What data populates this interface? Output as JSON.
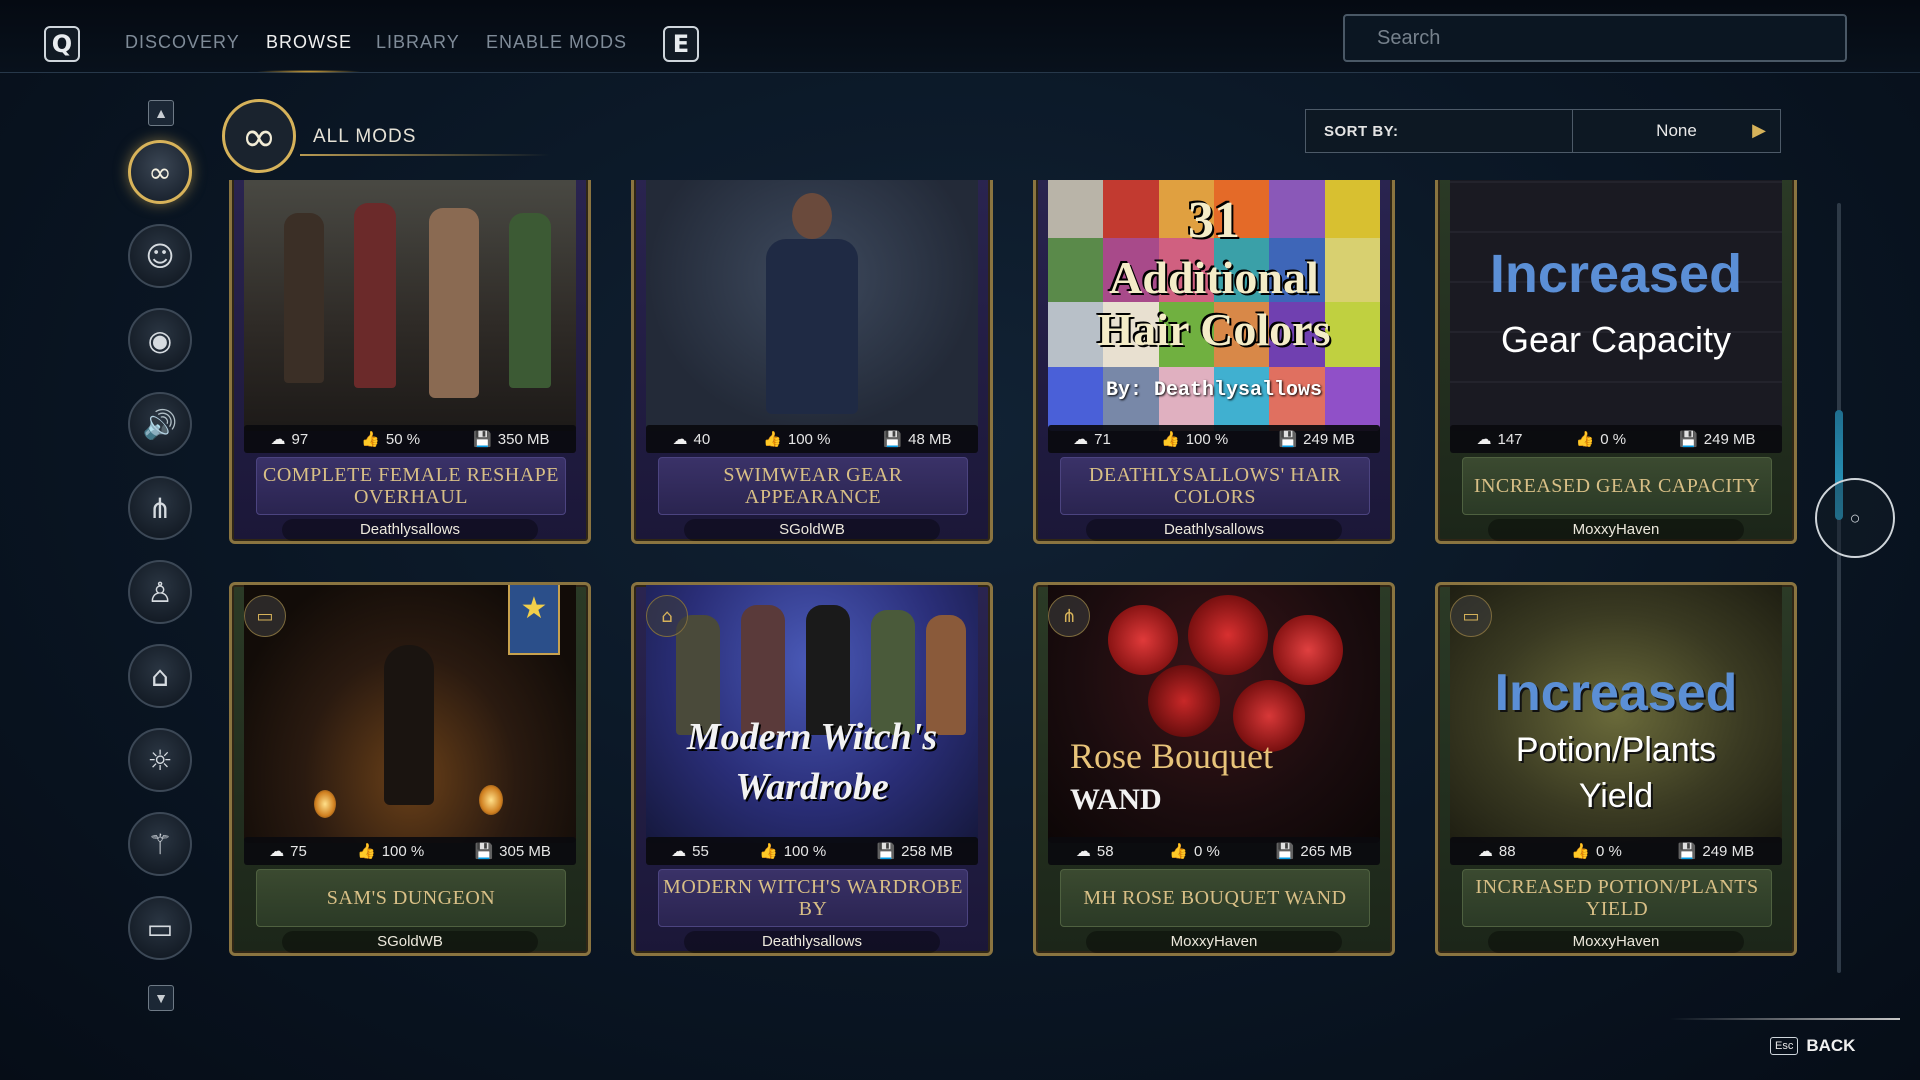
{
  "topbar": {
    "left_key": "Q",
    "right_key": "E",
    "tabs": [
      {
        "label": "DISCOVERY",
        "active": false
      },
      {
        "label": "BROWSE",
        "active": true
      },
      {
        "label": "LIBRARY",
        "active": false
      },
      {
        "label": "ENABLE MODS",
        "active": false
      }
    ],
    "search_placeholder": "Search"
  },
  "sidebar": {
    "items": [
      {
        "icon": "infinity-icon",
        "glyph": "∞",
        "active": true
      },
      {
        "icon": "head-icon",
        "glyph": "☺"
      },
      {
        "icon": "eye-icon",
        "glyph": "◉"
      },
      {
        "icon": "speaker-icon",
        "glyph": "🔊"
      },
      {
        "icon": "network-icon",
        "glyph": "⋔"
      },
      {
        "icon": "person-icon",
        "glyph": "♙"
      },
      {
        "icon": "outfit-icon",
        "glyph": "⌂"
      },
      {
        "icon": "lightbulb-icon",
        "glyph": "☼"
      },
      {
        "icon": "broom-icon",
        "glyph": "⚚"
      },
      {
        "icon": "gamepad-icon",
        "glyph": "▭"
      }
    ]
  },
  "category": {
    "label": "ALL MODS",
    "glyph": "∞"
  },
  "sort": {
    "label": "SORT BY:",
    "value": "None"
  },
  "mods": [
    {
      "title": "COMPLETE FEMALE RESHAPE OVERHAUL",
      "author": "Deathlysallows",
      "downloads": "97",
      "rating": "50 %",
      "size": "350 MB",
      "theme": "purple"
    },
    {
      "title": "SWIMWEAR GEAR APPEARANCE",
      "author": "SGoldWB",
      "downloads": "40",
      "rating": "100 %",
      "size": "48 MB",
      "theme": "purple"
    },
    {
      "title": "DEATHLYSALLOWS' HAIR COLORS",
      "author": "Deathlysallows",
      "downloads": "71",
      "rating": "100 %",
      "size": "249 MB",
      "theme": "purple",
      "art": {
        "line1": "31",
        "line2": "Additional",
        "line3": "Hair Colors",
        "byline": "By: Deathlysallows"
      }
    },
    {
      "title": "INCREASED GEAR CAPACITY",
      "author": "MoxxyHaven",
      "downloads": "147",
      "rating": "0 %",
      "size": "249 MB",
      "theme": "green",
      "art": {
        "line1": "Increased",
        "line2": "Gear Capacity"
      }
    },
    {
      "title": "SAM'S DUNGEON",
      "author": "SGoldWB",
      "downloads": "75",
      "rating": "100 %",
      "size": "305 MB",
      "theme": "green",
      "favorite": true
    },
    {
      "title": "MODERN WITCH'S WARDROBE BY",
      "author": "Deathlysallows",
      "downloads": "55",
      "rating": "100 %",
      "size": "258 MB",
      "theme": "purple",
      "art": {
        "line1": "Modern Witch's",
        "line2": "Wardrobe"
      }
    },
    {
      "title": "MH ROSE BOUQUET WAND",
      "author": "MoxxyHaven",
      "downloads": "58",
      "rating": "0 %",
      "size": "265 MB",
      "theme": "green",
      "art": {
        "line1": "Rose Bouquet",
        "line2": "WAND"
      }
    },
    {
      "title": "INCREASED POTION/PLANTS YIELD",
      "author": "MoxxyHaven",
      "downloads": "88",
      "rating": "0 %",
      "size": "249 MB",
      "theme": "green",
      "art": {
        "line1": "Increased",
        "line2": "Potion/Plants",
        "line3": "Yield"
      }
    }
  ],
  "footer": {
    "esc_key": "Esc",
    "back_label": "BACK"
  },
  "colors": {
    "gold": "#d6b25a",
    "purple_card": "#2a2450",
    "green_card": "#2b3a26",
    "scroll_accent": "#2aa0c8"
  }
}
